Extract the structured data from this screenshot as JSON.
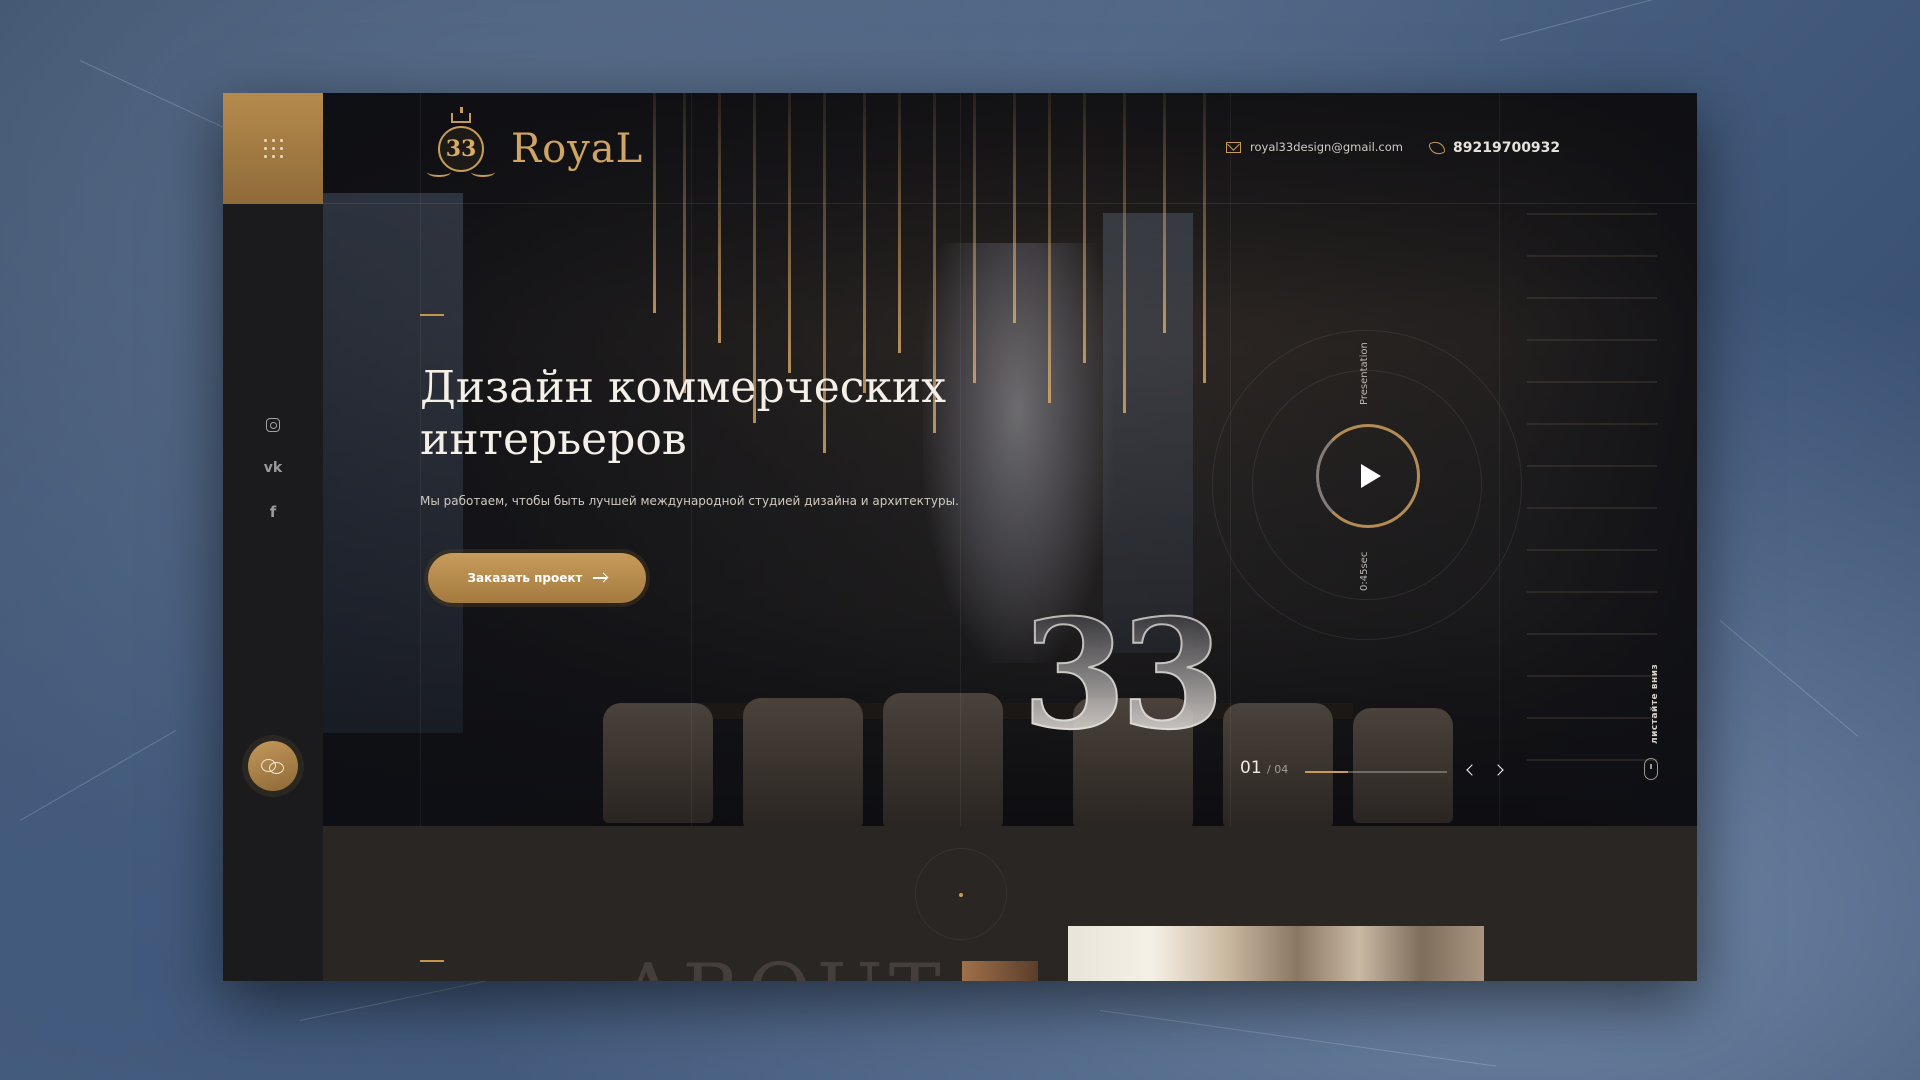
{
  "brand": {
    "logo_number": "33",
    "name": "RoyaL"
  },
  "header": {
    "email": "royal33design@gmail.com",
    "phone": "89219700932"
  },
  "hero": {
    "title_line1": "Дизайн коммерческих",
    "title_line2": "интерьеров",
    "subtitle": "Мы работаем, чтобы быть лучшей международной студией дизайна и архитектуры.",
    "cta_label": "Заказать проект",
    "big_number": "33"
  },
  "video": {
    "label": "Presentation",
    "duration": "0:45sec"
  },
  "slider": {
    "current": "01",
    "total": "/ 04",
    "progress": 0.3
  },
  "scroll_hint": "листайте вниз",
  "lower": {
    "section_word": "ABOUT"
  },
  "social": [
    "instagram",
    "vk",
    "facebook"
  ],
  "colors": {
    "accent": "#c2964f",
    "dark": "#17171a"
  }
}
